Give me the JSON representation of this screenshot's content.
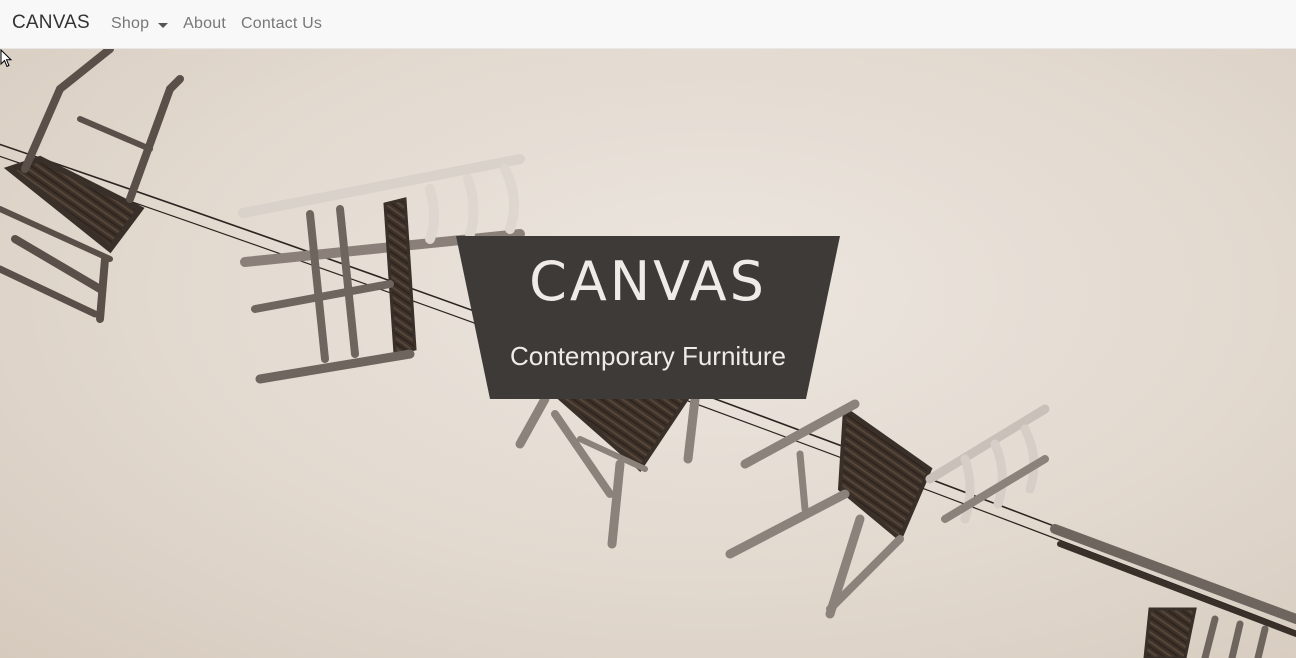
{
  "navbar": {
    "brand": "CANVAS",
    "links": [
      {
        "label": "Shop",
        "has_dropdown": true
      },
      {
        "label": "About"
      },
      {
        "label": "Contact Us"
      }
    ]
  },
  "hero": {
    "title": "CANVAS",
    "subtitle": "Contemporary Furniture",
    "banner_color": "#3e3a37",
    "text_color": "#f0ebe6"
  },
  "icons": {
    "dropdown": "caret-down-icon",
    "cursor": "mouse-pointer-icon"
  }
}
